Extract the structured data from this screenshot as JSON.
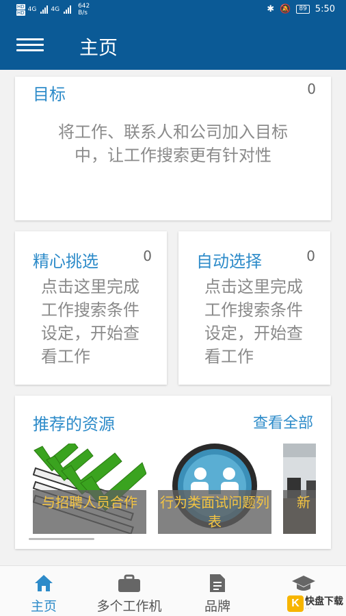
{
  "status_bar": {
    "network_1": "HD",
    "network_2": "HD",
    "net_1": "4G",
    "net_2": "4G",
    "speed_value": "642",
    "speed_unit": "B/s",
    "battery": "89",
    "time": "5:50"
  },
  "header": {
    "title": "主页",
    "menu_icon": "hamburger-menu-icon"
  },
  "target_card": {
    "title": "目标",
    "count": "0",
    "description": "将工作、联系人和公司加入目标中，让工作搜索更有针对性"
  },
  "cards": [
    {
      "title": "精心挑选",
      "count": "0",
      "description": "点击这里完成工作搜索条件设定，开始查看工作"
    },
    {
      "title": "自动选择",
      "count": "0",
      "description": "点击这里完成工作搜索条件设定，开始查看工作"
    }
  ],
  "resources": {
    "title": "推荐的资源",
    "view_all": "查看全部",
    "items": [
      {
        "caption": "与招聘人员合作",
        "image": "checkmarks-image"
      },
      {
        "caption": "行为类面试问题列表",
        "image": "interview-logo-image"
      },
      {
        "caption": "新",
        "image": "office-photo-image"
      }
    ]
  },
  "bottom_nav": {
    "items": [
      {
        "label": "主页",
        "icon": "home-icon",
        "active": true
      },
      {
        "label": "多个工作机",
        "icon": "briefcase-icon",
        "active": false
      },
      {
        "label": "品牌",
        "icon": "document-icon",
        "active": false
      },
      {
        "label": "",
        "icon": "graduation-cap-icon",
        "active": false
      }
    ]
  },
  "watermark": {
    "letter": "K",
    "text": "快盘下载"
  },
  "colors": {
    "primary": "#0b5a96",
    "accent_text": "#2d8bc9",
    "caption_text": "#f5c542"
  }
}
